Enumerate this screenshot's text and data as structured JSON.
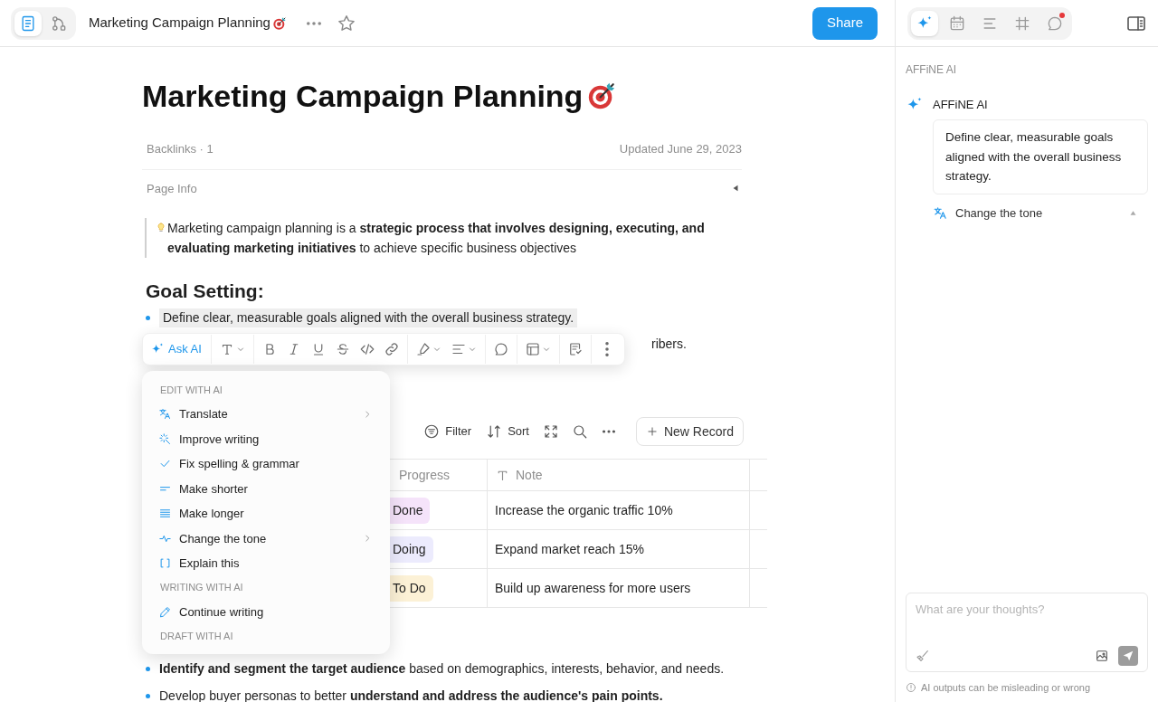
{
  "header": {
    "view_tabs": [
      {
        "kind": "page",
        "selected": true
      },
      {
        "kind": "edgeless",
        "selected": false
      }
    ],
    "title": "Marketing Campaign Planning",
    "share": "Share"
  },
  "sidebar_tabs": [
    {
      "kind": "ai",
      "selected": true,
      "unread": false
    },
    {
      "kind": "calendar",
      "selected": false,
      "unread": false
    },
    {
      "kind": "outline",
      "selected": false,
      "unread": false
    },
    {
      "kind": "frames",
      "selected": false,
      "unread": false
    },
    {
      "kind": "comments",
      "selected": false,
      "unread": true
    }
  ],
  "doc": {
    "title": "Marketing Campaign Planning",
    "backlinks": "Backlinks · 1",
    "updated": "Updated June 29, 2023",
    "page_info": {
      "label": "Page Info",
      "expanded": false
    },
    "callout": "Marketing campaign planning is a **strategic process that involves designing, executing, and evaluating marketing initiatives** to achieve specific business objectives",
    "heading": "Goal Setting:",
    "goal_bullets": [
      {
        "text": "Define clear, measurable goals aligned with the overall business strategy.",
        "selected": true
      },
      {
        "text": "ribers.",
        "selected": false
      }
    ],
    "database": {
      "toolbar": {
        "filter": "Filter",
        "sort": "Sort",
        "new_record": "New Record"
      },
      "columns": [
        {
          "label": "Progress",
          "kind": "select"
        },
        {
          "label": "Note",
          "kind": "text"
        }
      ],
      "rows": [
        {
          "progress": "Done",
          "color": "#f5e3fa",
          "note": "Increase the organic traffic 10%"
        },
        {
          "progress": "Doing",
          "color": "#ecebfd",
          "note": "Expand market reach 15%"
        },
        {
          "progress": "To Do",
          "color": "#fcf1d6",
          "note": "Build up awareness for more users"
        }
      ]
    },
    "audience_bullets": [
      {
        "text": "**Identify and segment the target audience** based on demographics, interests, behavior, and needs."
      },
      {
        "text": "Develop buyer personas to better **understand and address the audience's pain points.**"
      }
    ]
  },
  "format_toolbar": {
    "ask_ai": "Ask AI",
    "groups": [
      [
        {
          "kind": "text",
          "dropdown": true
        }
      ],
      [
        {
          "kind": "bold",
          "dropdown": false
        },
        {
          "kind": "italic",
          "dropdown": false
        },
        {
          "kind": "underline",
          "dropdown": false
        },
        {
          "kind": "strikethrough",
          "dropdown": false
        },
        {
          "kind": "code",
          "dropdown": false
        },
        {
          "kind": "link",
          "dropdown": false
        }
      ],
      [
        {
          "kind": "highlight",
          "dropdown": true
        },
        {
          "kind": "align",
          "dropdown": true
        }
      ],
      [
        {
          "kind": "comment",
          "dropdown": false
        }
      ],
      [
        {
          "kind": "layout",
          "dropdown": true
        }
      ],
      [
        {
          "kind": "note",
          "dropdown": false
        }
      ],
      [
        {
          "kind": "more",
          "dropdown": false
        }
      ]
    ]
  },
  "ai_menu": [
    {
      "section": "EDIT WITH AI",
      "items": [
        {
          "label": "Translate",
          "kind": "translate",
          "submenu": true
        },
        {
          "label": "Improve writing",
          "kind": "improve",
          "submenu": false
        },
        {
          "label": "Fix spelling & grammar",
          "kind": "check",
          "submenu": false
        },
        {
          "label": "Make shorter",
          "kind": "shorter",
          "submenu": false
        },
        {
          "label": "Make longer",
          "kind": "longer",
          "submenu": false
        },
        {
          "label": "Change the tone",
          "kind": "tone",
          "submenu": true
        },
        {
          "label": "Explain this",
          "kind": "explain",
          "submenu": false
        }
      ]
    },
    {
      "section": "WRITING WITH AI",
      "items": [
        {
          "label": "Continue writing",
          "kind": "pencil",
          "submenu": false
        }
      ]
    },
    {
      "section": "DRAFT WITH AI"
    }
  ],
  "ai_panel": {
    "heading": "AFFiNE AI",
    "sender": "AFFiNE AI",
    "quote": "Define clear, measurable goals aligned with the overall business strategy.",
    "action": {
      "label": "Change the tone",
      "expanded": true
    },
    "placeholder": "What are your thoughts?",
    "disclaimer": "AI outputs can be misleading or wrong"
  }
}
